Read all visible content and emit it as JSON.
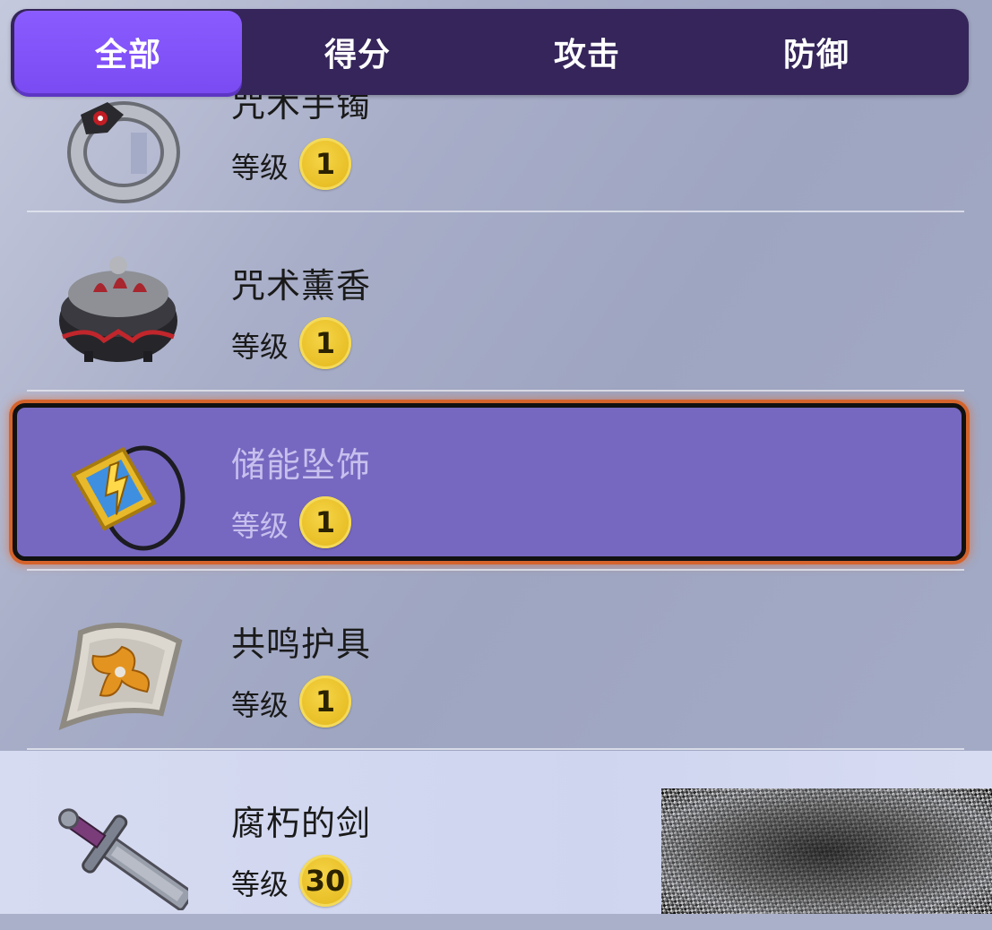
{
  "tabs": [
    {
      "label": "全部",
      "active": true
    },
    {
      "label": "得分",
      "active": false
    },
    {
      "label": "攻击",
      "active": false
    },
    {
      "label": "防御",
      "active": false
    }
  ],
  "items": [
    {
      "name": "咒术手镯",
      "level_label": "等级",
      "level": "1",
      "icon": "bracelet-icon"
    },
    {
      "name": "咒术薰香",
      "level_label": "等级",
      "level": "1",
      "icon": "incense-icon"
    },
    {
      "name": "储能坠饰",
      "level_label": "等级",
      "level": "1",
      "icon": "pendant-icon",
      "selected": true
    },
    {
      "name": "共鸣护具",
      "level_label": "等级",
      "level": "1",
      "icon": "guard-icon"
    },
    {
      "name": "腐朽的剑",
      "level_label": "等级",
      "level": "30",
      "icon": "sword-icon"
    }
  ],
  "colors": {
    "tabbar": "#35255a",
    "tab_active": "#8a5cff",
    "selected_row": "#7668c0",
    "selected_outline": "#d4632c",
    "level_badge": "#e7bd23"
  }
}
